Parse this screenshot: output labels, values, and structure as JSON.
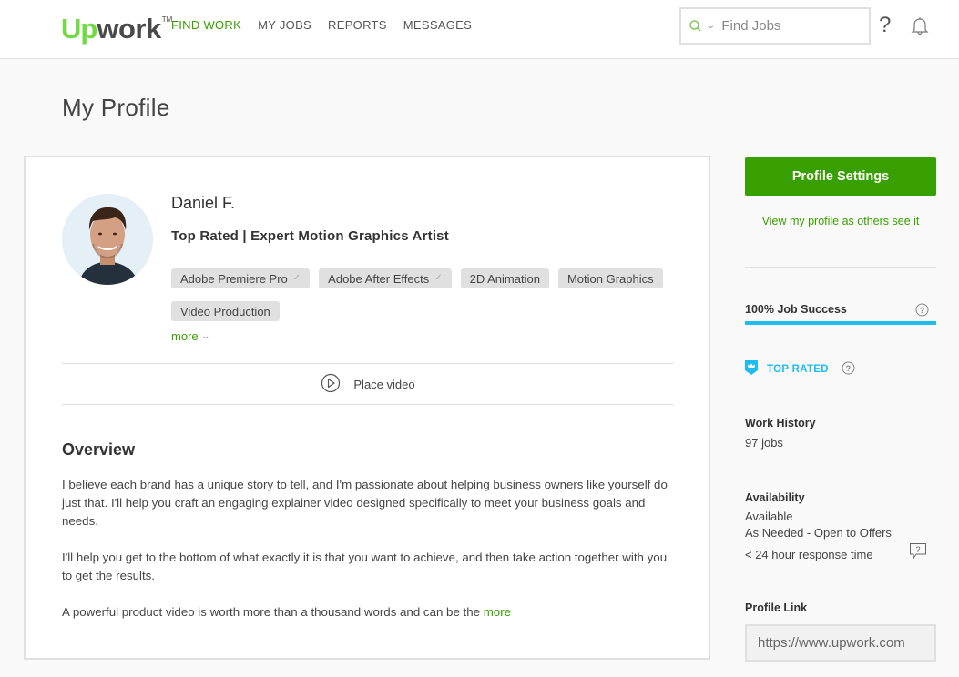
{
  "header": {
    "logo": {
      "up": "Up",
      "work": "work",
      "tm": "TM"
    },
    "nav": [
      {
        "label": "FIND WORK",
        "active": true
      },
      {
        "label": "MY JOBS",
        "active": false
      },
      {
        "label": "REPORTS",
        "active": false
      },
      {
        "label": "MESSAGES",
        "active": false
      }
    ],
    "search": {
      "placeholder": "Find Jobs",
      "value": ""
    },
    "help_label": "?",
    "icons": {
      "search": "search-icon",
      "dropdown": "chevron-down-icon",
      "help": "help-icon",
      "notifications": "bell-icon"
    }
  },
  "page": {
    "title": "My Profile"
  },
  "profile": {
    "name": "Daniel F.",
    "headline": "Top Rated | Expert Motion Graphics Artist",
    "skills": [
      {
        "label": "Adobe Premiere Pro",
        "verified": true
      },
      {
        "label": "Adobe After Effects",
        "verified": true
      },
      {
        "label": "2D Animation",
        "verified": false
      },
      {
        "label": "Motion Graphics",
        "verified": false
      },
      {
        "label": "Video Production",
        "verified": false
      }
    ],
    "skills_more": "more",
    "place_video": "Place video",
    "overview_title": "Overview",
    "overview_paragraphs": [
      "I believe each brand has a unique story to tell, and I'm passionate about helping business owners like yourself do just that. I'll help you craft an engaging explainer video designed specifically to meet your business goals and needs.",
      "I'll help you get to the bottom of what exactly it is that you want to achieve, and then take action together with you to get the results.",
      "A powerful product video is worth more than a thousand words and can be the "
    ],
    "overview_more": "more"
  },
  "sidebar": {
    "settings_button": "Profile Settings",
    "view_as_others": "View my profile as others see it",
    "job_success": {
      "label": "100% Job Success",
      "percent": 100
    },
    "top_rated": "TOP RATED",
    "work_history": {
      "title": "Work History",
      "value": "97 jobs"
    },
    "availability": {
      "title": "Availability",
      "status": "Available",
      "type": "As Needed - Open to Offers",
      "response": "< 24 hour response time"
    },
    "profile_link": {
      "title": "Profile Link",
      "value": "https://www.upwork.com"
    }
  },
  "colors": {
    "brand_green": "#37a000",
    "logo_green": "#6fda44",
    "accent_blue": "#1fbcf0"
  }
}
